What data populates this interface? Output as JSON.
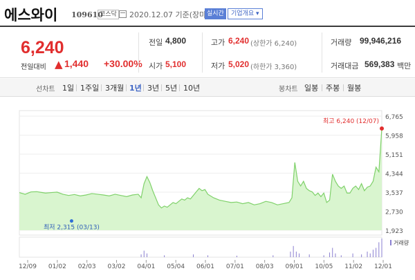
{
  "header": {
    "stock_name": "에스와이",
    "stock_code": "109610",
    "market": "코스닥",
    "date_text": "2020.12.07 기준(장마감)",
    "realtime_label": "실시간",
    "company_overview_label": "기업개요 ▾"
  },
  "price": {
    "current": "6,240",
    "change_label": "전일대비",
    "change_value": "1,440",
    "change_percent": "+30.00%",
    "direction_icon": "up-triangle-icon",
    "up_color": "#e12e2e"
  },
  "quote": {
    "prev_close_label": "전일",
    "prev_close": "4,800",
    "open_label": "시가",
    "open": "5,100",
    "high_label": "고가",
    "high": "6,240",
    "high_note": "(상한가 6,240)",
    "low_label": "저가",
    "low": "5,020",
    "low_note": "(하한가 3,360)",
    "volume_label": "거래량",
    "volume": "99,946,216",
    "amount_label": "거래대금",
    "amount": "569,383",
    "amount_unit": "백만"
  },
  "tabs": {
    "line_label": "선차트",
    "line_tabs": [
      "1일",
      "1주일",
      "3개월",
      "1년",
      "3년",
      "5년",
      "10년"
    ],
    "active": "1년",
    "candle_label": "봉차트",
    "candle_tabs": [
      "일봉",
      "주봉",
      "월봉"
    ]
  },
  "chart_data": {
    "type": "area",
    "y_ticks": [
      "6,765",
      "5,958",
      "5,151",
      "4,344",
      "3,537",
      "2,730",
      "1,923"
    ],
    "ylim": [
      1923,
      6765
    ],
    "x_ticks": [
      "12/09",
      "01/02",
      "02/03",
      "03/02",
      "04/01",
      "05/04",
      "06/01",
      "07/01",
      "08/03",
      "09/01",
      "10/05",
      "11/02",
      "12/01"
    ],
    "x": [
      0,
      4,
      8,
      12,
      15,
      18,
      22,
      26,
      30,
      34,
      38,
      42,
      46,
      50,
      54,
      58,
      62,
      66,
      70,
      74,
      78,
      82,
      84,
      86,
      88,
      90,
      92,
      94,
      96,
      98,
      100,
      102,
      104,
      106,
      108,
      110,
      112,
      114,
      116,
      118,
      120,
      122,
      124,
      126,
      128,
      130,
      134,
      138,
      142,
      146,
      150,
      154,
      158,
      162,
      166,
      170,
      174,
      178,
      182,
      186,
      188,
      190,
      192,
      194,
      196,
      198,
      200,
      202,
      204,
      206,
      208,
      210,
      212,
      214,
      216,
      218,
      220,
      222,
      224,
      226,
      228,
      230,
      232,
      234,
      236,
      238,
      240,
      242,
      244,
      246,
      248,
      250
    ],
    "series": [
      {
        "values": [
          3520,
          3450,
          3550,
          3560,
          3530,
          3500,
          3520,
          3540,
          3450,
          3400,
          3440,
          3380,
          3420,
          3480,
          3450,
          3420,
          3380,
          3450,
          3400,
          3350,
          3420,
          3450,
          3300,
          3900,
          4200,
          3950,
          3600,
          3300,
          3000,
          2870,
          2950,
          2900,
          3000,
          3100,
          3050,
          3150,
          3250,
          3200,
          3300,
          3250,
          3400,
          3550,
          3700,
          3600,
          3650,
          3450,
          3300,
          3200,
          3150,
          3100,
          3120,
          3050,
          3100,
          3000,
          3050,
          3150,
          3100,
          3000,
          3050,
          3100,
          3300,
          4800,
          4000,
          3800,
          4000,
          3700,
          3600,
          3550,
          3400,
          3500,
          3350,
          3500,
          3100,
          3200,
          4300,
          4000,
          3800,
          3700,
          3800,
          3500,
          3500,
          3700,
          3800,
          3650,
          3900,
          3600,
          3750,
          3800,
          4000,
          4600,
          4400,
          6240
        ]
      }
    ],
    "max_label": "최고 6,240 (12/07)",
    "min_label": "최저 2,315 (03/13)",
    "volume_label": "거래량",
    "line_color": "#7fd16a",
    "fill_color": "#d9f5cf",
    "max_marker_color": "#e12e2e",
    "min_marker_color": "#2f6fd6"
  }
}
